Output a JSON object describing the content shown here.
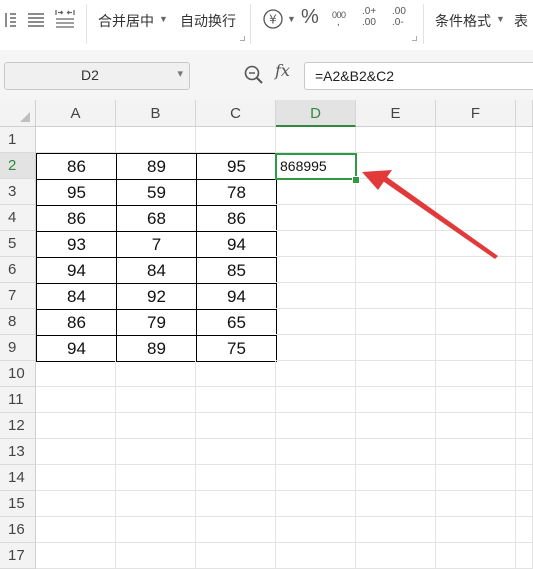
{
  "ribbon": {
    "merge_center": "合并居中",
    "wrap_text": "自动换行",
    "currency_symbol": "¥",
    "percent_symbol": "%",
    "thousands_symbol": "000",
    "inc_decimal": ".0+\n.00",
    "dec_decimal": ".00\n.0-",
    "conditional_format": "条件格式",
    "table_style_partial": "表"
  },
  "formula_bar": {
    "name_box": "D2",
    "fx_label": "fx",
    "formula": "=A2&B2&C2"
  },
  "columns": [
    "A",
    "B",
    "C",
    "D",
    "E",
    "F"
  ],
  "selected_column": "D",
  "rows": [
    "1",
    "2",
    "3",
    "4",
    "5",
    "6",
    "7",
    "8",
    "9",
    "10",
    "11",
    "12",
    "13",
    "14",
    "15",
    "16",
    "17"
  ],
  "selected_row": "2",
  "table": [
    [
      "86",
      "89",
      "95"
    ],
    [
      "95",
      "59",
      "78"
    ],
    [
      "86",
      "68",
      "86"
    ],
    [
      "93",
      "7",
      "94"
    ],
    [
      "94",
      "84",
      "85"
    ],
    [
      "84",
      "92",
      "94"
    ],
    [
      "86",
      "79",
      "65"
    ],
    [
      "94",
      "89",
      "75"
    ]
  ],
  "result_cell": {
    "ref": "D2",
    "value": "868995"
  },
  "colors": {
    "selection": "#2f9a44",
    "arrow": "#e23a3a"
  }
}
